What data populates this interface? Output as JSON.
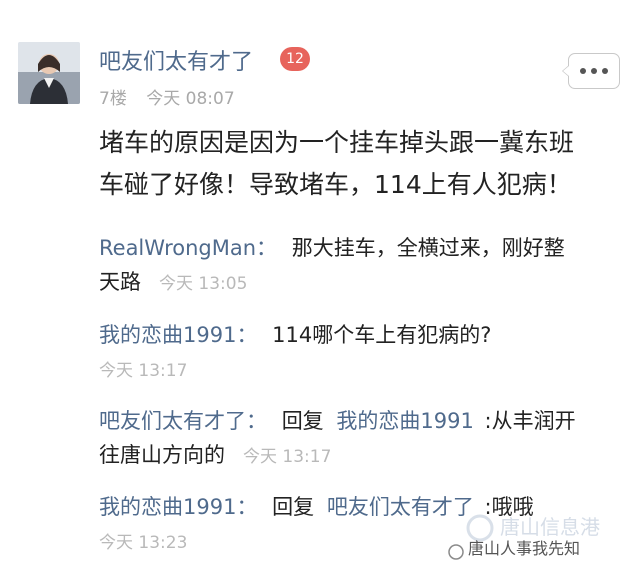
{
  "post": {
    "username": "吧友们太有才了",
    "level": "12",
    "floor": "7楼",
    "time": "今天 08:07",
    "body_line1": "堵车的原因是因为一个挂车掉头跟一冀东班",
    "body_line2": "车碰了好像！导致堵车，114上有人犯病！"
  },
  "replies": [
    {
      "name": "RealWrongMan：",
      "text1": "那大挂车，全横过来，刚好整",
      "text2": "天路",
      "time": "今天 13:05"
    },
    {
      "name": "我的恋曲1991：",
      "text1": "114哪个车上有犯病的?",
      "time": "今天 13:17"
    },
    {
      "name": "吧友们太有才了：",
      "reply_word": "回复",
      "target": "我的恋曲1991",
      "text1": ":从丰润开",
      "text2": "往唐山方向的",
      "time": "今天 13:17"
    },
    {
      "name": "我的恋曲1991：",
      "reply_word": "回复",
      "target": "吧友们太有才了",
      "text1": ":哦哦",
      "time": "今天 13:23"
    }
  ],
  "watermark": {
    "text": "唐山人事我先知",
    "logo_text": "唐山信息港"
  },
  "icons": {
    "more": "more-dots-icon",
    "avatar": "avatar-photo"
  },
  "colors": {
    "name": "#4f6a8c",
    "badge": "#e7645c",
    "time": "#b9b9b9"
  }
}
